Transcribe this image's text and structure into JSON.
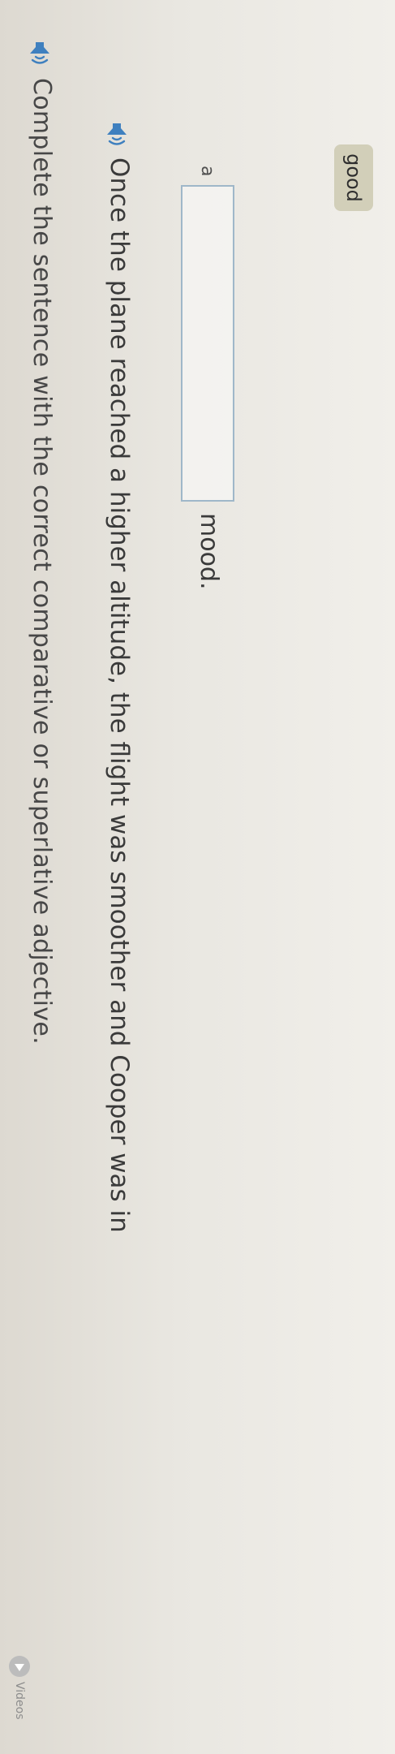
{
  "instruction": {
    "text": "Complete the sentence with the correct comparative or superlative adjective."
  },
  "videos": {
    "label": "Videos"
  },
  "question": {
    "sentence": "Once the plane reached a higher altitude, the flight was smoother and Cooper was in",
    "blank_prefix": "a",
    "blank_suffix": "mood."
  },
  "word_bank": {
    "word": "good"
  },
  "colors": {
    "audio_icon": "#3f80bf",
    "blank_border": "#9fb7c9",
    "word_chip": "#d2cfb9"
  },
  "icons": [
    "speaker-icon",
    "play-icon"
  ]
}
